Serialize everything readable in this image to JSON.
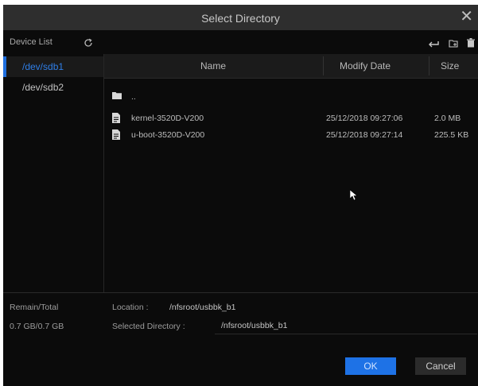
{
  "dialog": {
    "title": "Select Directory",
    "close_glyph": "✕"
  },
  "toolbar": {
    "device_list_label": "Device List",
    "icons": [
      "refresh-icon",
      "back-icon",
      "new-folder-icon",
      "delete-icon"
    ]
  },
  "devices": [
    {
      "label": "/dev/sdb1",
      "selected": true
    },
    {
      "label": "/dev/sdb2",
      "selected": false
    }
  ],
  "columns": {
    "name": "Name",
    "modify_date": "Modify Date",
    "size": "Size"
  },
  "files": [
    {
      "type": "folder",
      "name": "..",
      "date": "",
      "size": ""
    },
    {
      "type": "file",
      "name": "kernel-3520D-V200",
      "date": "25/12/2018 09:27:06",
      "size": "2.0 MB"
    },
    {
      "type": "file",
      "name": "u-boot-3520D-V200",
      "date": "25/12/2018 09:27:14",
      "size": "225.5 KB"
    }
  ],
  "footer": {
    "remain_total_label": "Remain/Total",
    "remain_total_value": "0.7 GB/0.7 GB",
    "location_label": "Location :",
    "location_value": "/nfsroot/usbbk_b1",
    "selected_dir_label": "Selected Directory :",
    "selected_dir_value": "/nfsroot/usbbk_b1"
  },
  "buttons": {
    "ok": "OK",
    "cancel": "Cancel"
  },
  "colors": {
    "accent": "#1e72e6",
    "selected_text": "#2f7fe8",
    "background": "#0b0b0b",
    "titlebar": "#2e2e2e"
  }
}
